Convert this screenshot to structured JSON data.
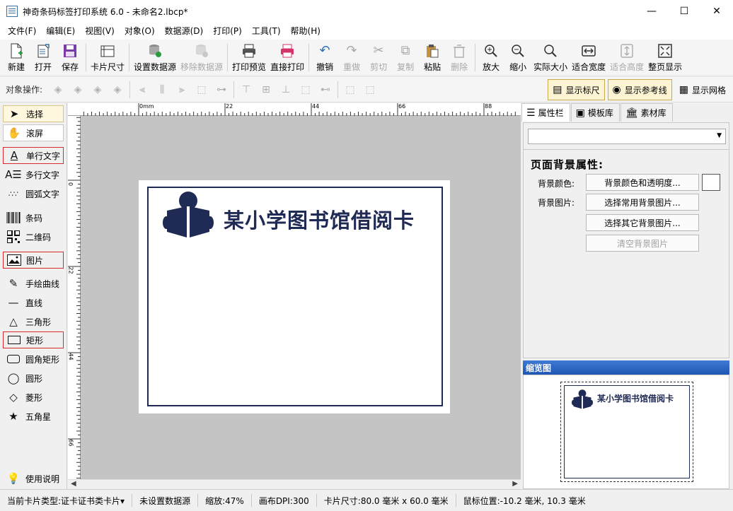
{
  "window": {
    "title": "神奇条码标签打印系统 6.0 - 未命名2.lbcp*",
    "minimize": "—",
    "maximize": "☐",
    "close": "✕"
  },
  "menu": [
    "文件(F)",
    "编辑(E)",
    "视图(V)",
    "对象(O)",
    "数据源(D)",
    "打印(P)",
    "工具(T)",
    "帮助(H)"
  ],
  "toolbar": {
    "new": "新建",
    "open": "打开",
    "save": "保存",
    "card_size": "卡片尺寸",
    "set_datasource": "设置数据源",
    "remove_datasource": "移除数据源",
    "print_preview": "打印预览",
    "direct_print": "直接打印",
    "undo": "撤销",
    "redo": "重做",
    "cut": "剪切",
    "copy": "复制",
    "paste": "粘贴",
    "delete": "删除",
    "zoom_in": "放大",
    "zoom_out": "缩小",
    "actual_size": "实际大小",
    "fit_width": "适合宽度",
    "fit_height": "适合高度",
    "fit_page": "整页显示"
  },
  "objbar": {
    "label": "对象操作:",
    "show_ruler": "显示标尺",
    "show_guides": "显示参考线",
    "show_grid": "显示网格"
  },
  "palette": {
    "select": "选择",
    "scroll": "滚屏",
    "single_text": "单行文字",
    "multi_text": "多行文字",
    "arc_text": "圆弧文字",
    "barcode": "条码",
    "qrcode": "二维码",
    "image": "图片",
    "freehand": "手绘曲线",
    "line": "直线",
    "triangle": "三角形",
    "rect": "矩形",
    "round_rect": "圆角矩形",
    "circle": "圆形",
    "diamond": "菱形",
    "star": "五角星",
    "help": "使用说明"
  },
  "ruler": {
    "top_labels": [
      "0mm",
      "22",
      "44",
      "66",
      "88"
    ],
    "left_labels": [
      "0",
      "22",
      "44",
      "66"
    ]
  },
  "card": {
    "title": "某小学图书馆借阅卡",
    "accent": "#1f2a55"
  },
  "rpanel": {
    "tabs": [
      "属性栏",
      "模板库",
      "素材库"
    ],
    "section_title": "页面背景属性:",
    "bg_color_label": "背景颜色:",
    "bg_image_label": "背景图片:",
    "btn_bg_color": "背景颜色和透明度...",
    "btn_common_bg": "选择常用背景图片...",
    "btn_other_bg": "选择其它背景图片...",
    "btn_clear_bg": "清空背景图片",
    "preview_title": "缩览图"
  },
  "status": {
    "card_type": "当前卡片类型:证卡证书类卡片▾",
    "datasource": "未设置数据源",
    "zoom": "缩放:47%",
    "dpi": "画布DPI:300",
    "card_size": "卡片尺寸:80.0 毫米 x 60.0 毫米",
    "mouse_pos": "鼠标位置:-10.2 毫米, 10.3 毫米"
  }
}
